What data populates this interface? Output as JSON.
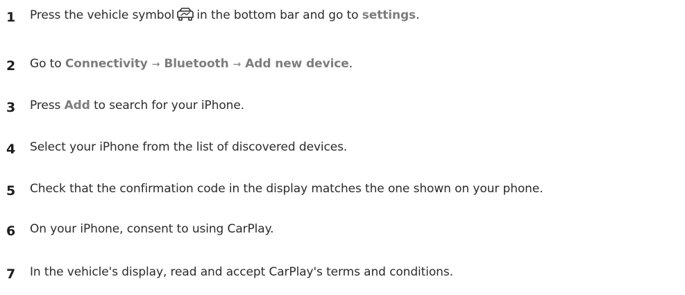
{
  "steps": [
    {
      "number": "1",
      "text_before": "Press the vehicle symbol",
      "icon": "vehicle-symbol-icon",
      "text_mid": "in the bottom bar and go to",
      "highlight": "settings",
      "text_after": "."
    },
    {
      "number": "2",
      "text_before": "Go to",
      "path": [
        "Connectivity",
        "Bluetooth",
        "Add new device"
      ],
      "arrow": "→",
      "text_after": "."
    },
    {
      "number": "3",
      "text_before": "Press",
      "highlight": "Add",
      "text_after": "to search for your iPhone."
    },
    {
      "number": "4",
      "text": "Select your iPhone from the list of discovered devices."
    },
    {
      "number": "5",
      "text": "Check that the confirmation code in the display matches the one shown on your phone."
    },
    {
      "number": "6",
      "text": "On your iPhone, consent to using CarPlay."
    },
    {
      "number": "7",
      "text": "In the vehicle's display, read and accept CarPlay's terms and conditions."
    }
  ],
  "colors": {
    "text": "#2b2b2b",
    "number": "#1e1e1e",
    "highlight": "#7d7d7d"
  }
}
